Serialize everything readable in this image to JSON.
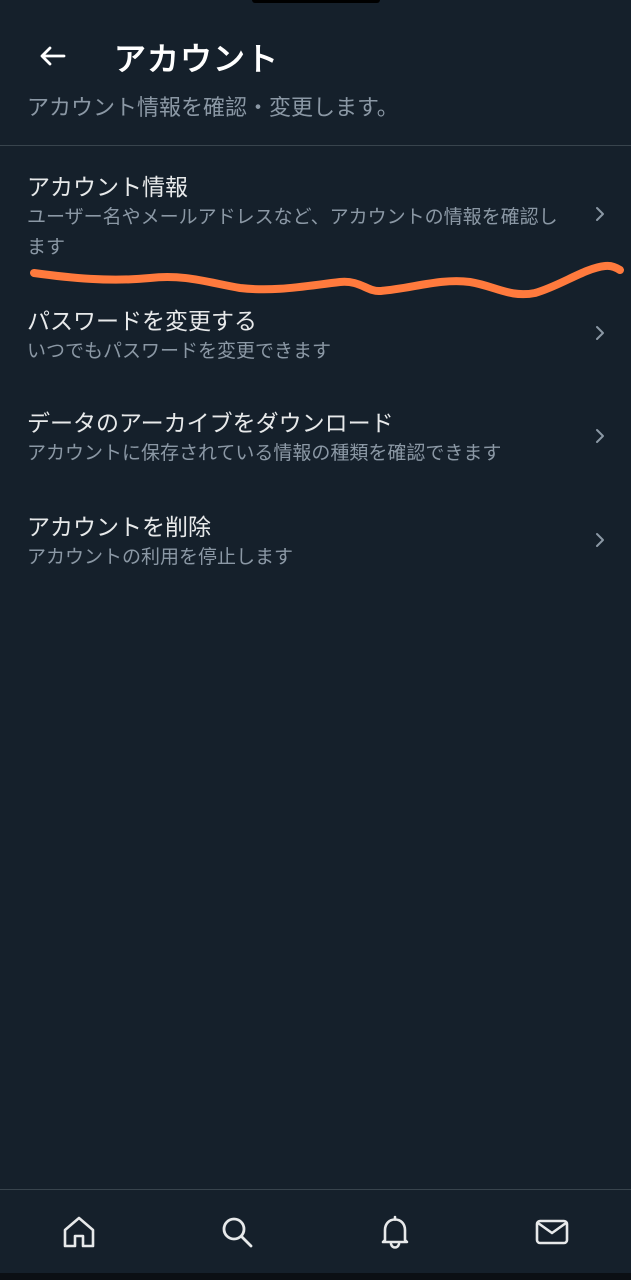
{
  "header": {
    "title": "アカウント",
    "subtitle": "アカウント情報を確認・変更します。",
    "back_icon": "arrow-left-icon"
  },
  "menu": {
    "items": [
      {
        "title": "アカウント情報",
        "description": "ユーザー名やメールアドレスなど、アカウントの情報を確認します"
      },
      {
        "title": "パスワードを変更する",
        "description": "いつでもパスワードを変更できます"
      },
      {
        "title": "データのアーカイブをダウンロード",
        "description": "アカウントに保存されている情報の種類を確認できます"
      },
      {
        "title": "アカウントを削除",
        "description": "アカウントの利用を停止します"
      }
    ]
  },
  "annotation": {
    "color": "#ff7a3d"
  },
  "bottom_nav": {
    "items": [
      {
        "icon": "home-icon"
      },
      {
        "icon": "search-icon"
      },
      {
        "icon": "bell-icon"
      },
      {
        "icon": "mail-icon"
      }
    ]
  },
  "colors": {
    "background": "#15202b",
    "text_primary": "#e7e9ea",
    "text_secondary": "#8b98a5",
    "divider": "#38444d"
  }
}
